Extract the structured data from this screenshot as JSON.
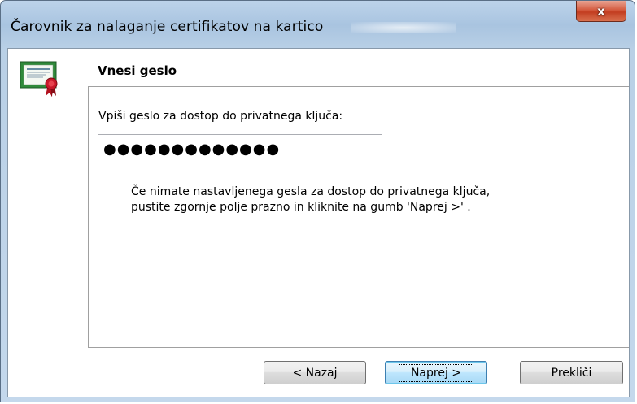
{
  "window": {
    "title": "Čarovnik za nalaganje certifikatov na kartico",
    "close_symbol": "x"
  },
  "header": {
    "title": "Vnesi geslo",
    "icon": "certificate-icon"
  },
  "form": {
    "prompt": "Vpiši geslo za dostop do privatnega ključa:",
    "password_masked": "●●●●●●●●●●●●●",
    "hint_line1": "Če nimate nastavljenega gesla za dostop do privatnega ključa,",
    "hint_line2": "pustite zgornje polje prazno in kliknite na gumb 'Naprej >' ."
  },
  "buttons": {
    "back": "< Nazaj",
    "next": "Naprej >",
    "cancel": "Prekliči"
  },
  "colors": {
    "titlebar": "#a9c4e0",
    "close_button": "#c33d20",
    "default_button_border": "#3c7fb1"
  }
}
